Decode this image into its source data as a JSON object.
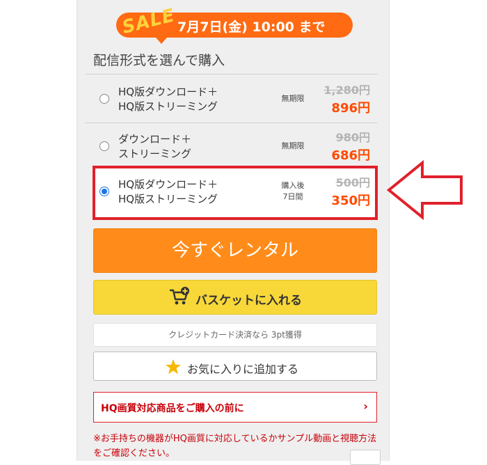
{
  "sale_banner": {
    "badge": "SALE",
    "text": "7月7日(金) 10:00 まで"
  },
  "section_title": "配信形式を選んで購入",
  "options": [
    {
      "label_line1": "HQ版ダウンロード＋",
      "label_line2": "HQ版ストリーミング",
      "term_line1": "無期限",
      "term_line2": "",
      "old_price": "1,280円",
      "new_price": "896円",
      "selected": false
    },
    {
      "label_line1": "ダウンロード＋",
      "label_line2": "ストリーミング",
      "term_line1": "無期限",
      "term_line2": "",
      "old_price": "980円",
      "new_price": "686円",
      "selected": false
    },
    {
      "label_line1": "HQ版ダウンロード＋",
      "label_line2": "HQ版ストリーミング",
      "term_line1": "購入後",
      "term_line2": "7日間",
      "old_price": "500円",
      "new_price": "350円",
      "selected": true
    }
  ],
  "buttons": {
    "rent_now": "今すぐレンタル",
    "add_to_basket": "バスケットに入れる",
    "add_to_favorites": "お気に入りに追加する"
  },
  "points_note": "クレジットカード決済なら 3pt獲得",
  "hq_link": {
    "label": "HQ画質対応商品をご購入の前に",
    "chevron": "›"
  },
  "notice": "※お手持ちの機器がHQ画質に対応しているかサンプル動画と視聴方法をご確認ください。",
  "colors": {
    "sale_orange": "#ff6a13",
    "price_red": "#ff4a00",
    "rent_orange": "#ff8c1a",
    "basket_yellow": "#f8d838",
    "highlight_red": "#e0212b"
  },
  "icons": {
    "cart": "cart-plus-icon",
    "star": "star-icon",
    "annotation": "left-arrow-icon"
  }
}
